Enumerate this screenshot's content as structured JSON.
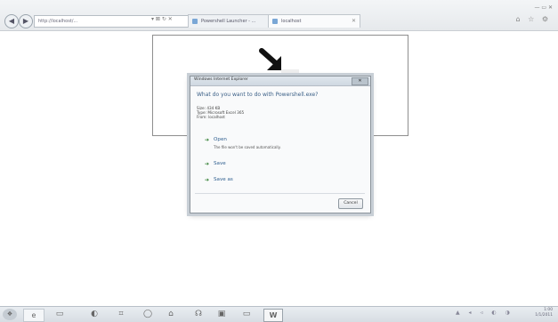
{
  "browser": {
    "address_url": "http://localhost/...",
    "address_controls": "▾ ⊠ ↻ ✕",
    "tabs": [
      {
        "label": "Powershell Launcher - ..."
      },
      {
        "label": "localhost"
      }
    ],
    "tab_close": "✕",
    "toolbar_icons": "⌂ ☆ ⚙",
    "window_controls": "— ▭ ✕"
  },
  "dialog": {
    "title": "Windows Internet Explorer",
    "close_label": "✕",
    "question": "What do you want to do with Powershell.exe?",
    "info": {
      "size": "Size: 434 KB",
      "type": "Type: Microsoft Excel 365",
      "from": "From: localhost"
    },
    "options": {
      "open_label": "Open",
      "open_desc": "The file won't be saved automatically.",
      "save_label": "Save",
      "save_as_label": "Save as"
    },
    "option_arrow": "➔",
    "cancel_label": "Cancel"
  },
  "taskbar": {
    "start_glyph": "❖",
    "items": {
      "ie": "e",
      "explorer": "▭",
      "media": "◐",
      "app1": "⌗",
      "app2": "◯",
      "app3": "⌂",
      "app4": "☊",
      "app5": "▣",
      "app6": "▭",
      "word": "W"
    },
    "tray_icons": "▲ ◂ ◃ ◐ ◑",
    "clock_time": "1:00",
    "clock_date": "1/1/2011"
  },
  "colors": {
    "dialog_question": "#3a5f86",
    "option_arrow": "#2a7a2a",
    "page_border": "#8e8e8e"
  }
}
